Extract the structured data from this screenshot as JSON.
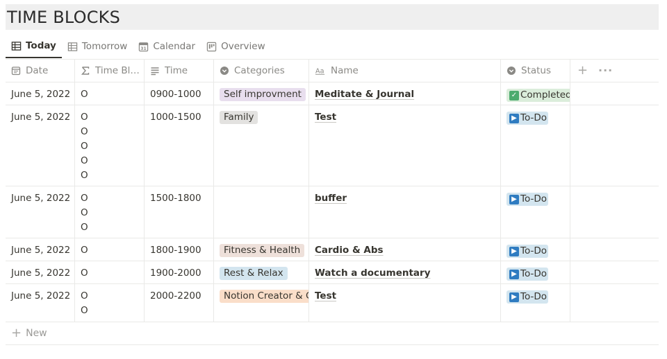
{
  "page": {
    "title": "TIME BLOCKS"
  },
  "tabs": [
    {
      "label": "Today",
      "icon": "table-icon",
      "active": true
    },
    {
      "label": "Tomorrow",
      "icon": "table-icon",
      "active": false
    },
    {
      "label": "Calendar",
      "icon": "calendar-icon",
      "active": false
    },
    {
      "label": "Overview",
      "icon": "board-icon",
      "active": false
    }
  ],
  "columns": [
    {
      "label": "Date",
      "icon": "date-icon"
    },
    {
      "label": "Time Bl…",
      "icon": "formula-sigma-icon"
    },
    {
      "label": "Time",
      "icon": "text-lines-icon"
    },
    {
      "label": "Categories",
      "icon": "select-icon"
    },
    {
      "label": "Name",
      "icon": "title-aa-icon"
    },
    {
      "label": "Status",
      "icon": "select-icon"
    }
  ],
  "rows": [
    {
      "date": "June 5, 2022",
      "blocks": [
        "O"
      ],
      "time": "0900-1000",
      "category": "Self improvment",
      "category_color": "#e8deee",
      "name": "Meditate & Journal",
      "status": "Completed",
      "status_color": "#dbeddb",
      "status_icon": "check-box-icon"
    },
    {
      "date": "June 5, 2022",
      "blocks": [
        "O",
        "O",
        "O",
        "O",
        "O"
      ],
      "time": "1000-1500",
      "category": "Family",
      "category_color": "#e3e2e0",
      "name": "Test",
      "status": "To-Do",
      "status_color": "#d3e5ef",
      "status_icon": "play-box-icon"
    },
    {
      "date": "June 5, 2022",
      "blocks": [
        "O",
        "O",
        "O"
      ],
      "time": "1500-1800",
      "category": "",
      "category_color": "",
      "name": "buffer",
      "status": "To-Do",
      "status_color": "#d3e5ef",
      "status_icon": "play-box-icon"
    },
    {
      "date": "June 5, 2022",
      "blocks": [
        "O"
      ],
      "time": "1800-1900",
      "category": "Fitness & Health",
      "category_color": "#eee0da",
      "name": "Cardio & Abs",
      "status": "To-Do",
      "status_color": "#d3e5ef",
      "status_icon": "play-box-icon"
    },
    {
      "date": "June 5, 2022",
      "blocks": [
        "O"
      ],
      "time": "1900-2000",
      "category": "Rest & Relax",
      "category_color": "#d3e5ef",
      "name": "Watch a documentary",
      "status": "To-Do",
      "status_color": "#d3e5ef",
      "status_icon": "play-box-icon"
    },
    {
      "date": "June 5, 2022",
      "blocks": [
        "O",
        "O"
      ],
      "time": "2000-2200",
      "category": "Notion Creator & Co",
      "category_color": "#fadec9",
      "name": "Test",
      "status": "To-Do",
      "status_color": "#d3e5ef",
      "status_icon": "play-box-icon"
    }
  ],
  "footer": {
    "new_label": "New"
  },
  "colors": {
    "border": "#e9e9e7",
    "text": "#37352f",
    "muted": "#8a8985",
    "title_bg": "#efefef",
    "check": "#4dab6e",
    "play": "#2f7cc1"
  }
}
